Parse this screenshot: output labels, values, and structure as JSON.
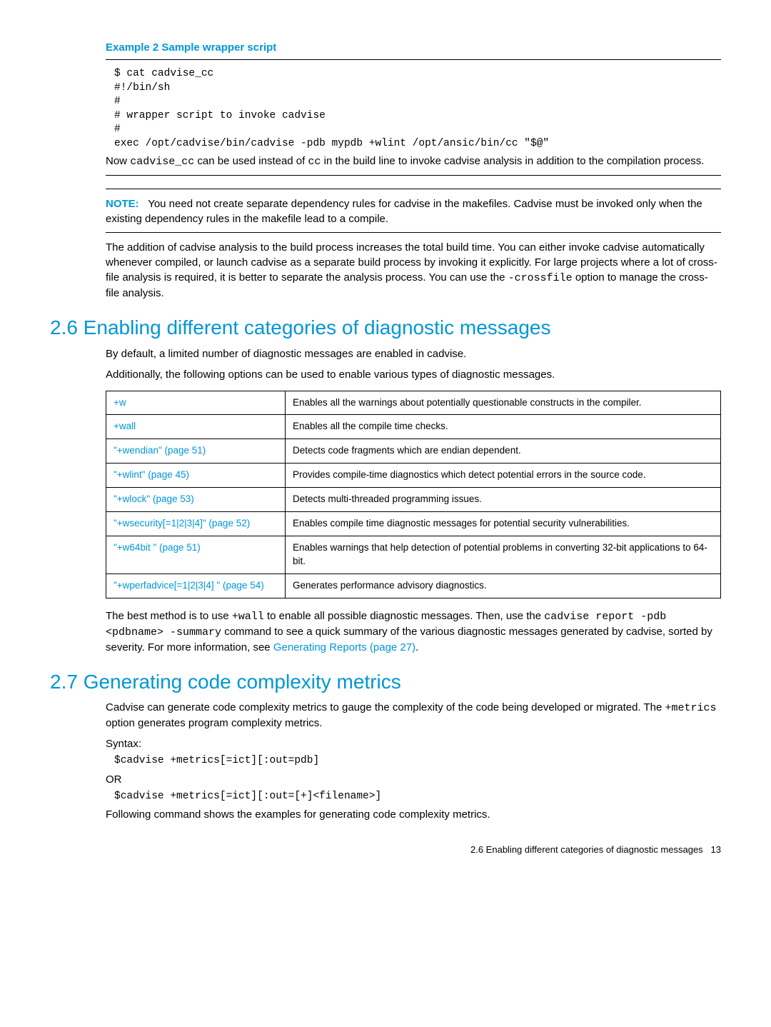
{
  "example": {
    "title": "Example 2 Sample wrapper script",
    "code": "$ cat cadvise_cc\n#!/bin/sh\n#\n# wrapper script to invoke cadvise\n#\nexec /opt/cadvise/bin/cadvise -pdb mypdb +wlint /opt/ansic/bin/cc \"$@\"",
    "after1a": "Now ",
    "after1b": "cadvise_cc",
    "after1c": " can be used instead of ",
    "after1d": "cc",
    "after1e": " in the build line to invoke cadvise analysis in addition to the compilation process."
  },
  "note": {
    "label": "NOTE:",
    "text": "You need not create separate dependency rules for cadvise in the makefiles. Cadvise must be invoked only when the existing dependency rules in the makefile lead to a compile."
  },
  "paraAfterNote_a": "The addition of cadvise analysis to the build process increases the total build time. You can either invoke cadvise automatically whenever compiled, or launch cadvise as a separate build process by invoking it explicitly. For large projects where a lot of cross-file analysis is required, it is better to separate the analysis process. You can use the ",
  "paraAfterNote_b": "-crossfile",
  "paraAfterNote_c": " option to manage the cross-file analysis.",
  "sec26": {
    "heading": "2.6 Enabling different categories of diagnostic messages",
    "p1": "By default, a limited number of diagnostic messages are enabled in cadvise.",
    "p2": "Additionally, the following options can be used to enable various types of diagnostic messages.",
    "rows": [
      {
        "opt": "+w",
        "desc": "Enables all the warnings about potentially questionable constructs in the compiler."
      },
      {
        "opt": "+wall",
        "desc": "Enables all the compile time checks."
      },
      {
        "opt": "\"+wendian\" (page 51)",
        "desc": "Detects code fragments which are endian dependent."
      },
      {
        "opt": "\"+wlint\" (page 45)",
        "desc": "Provides compile-time diagnostics which detect potential errors in the source code."
      },
      {
        "opt": "\"+wlock\" (page 53)",
        "desc": "Detects multi-threaded programming issues."
      },
      {
        "opt": "\"+wsecurity[=1|2|3|4]\" (page 52)",
        "desc": "Enables compile time diagnostic messages for potential security vulnerabilities."
      },
      {
        "opt": "\"+w64bit \" (page 51)",
        "desc": "Enables warnings that help detection of potential problems in converting 32-bit applications to 64-bit."
      },
      {
        "opt": "\"+wperfadvice[=1|2|3|4] \" (page 54)",
        "desc": "Generates performance advisory diagnostics."
      }
    ],
    "p3a": "The best method is to use ",
    "p3b": "+wall",
    "p3c": " to enable all possible diagnostic messages. Then, use the ",
    "p3d": "cadvise report -pdb <pdbname> -summary",
    "p3e": " command to see a quick summary of the various diagnostic messages generated by cadvise, sorted by severity. For more information, see ",
    "p3link": "Generating Reports (page 27)",
    "p3f": "."
  },
  "sec27": {
    "heading": "2.7 Generating code complexity metrics",
    "p1a": "Cadvise can generate code complexity metrics to gauge the complexity of the code being developed or migrated. The ",
    "p1b": "+metrics",
    "p1c": " option generates program complexity metrics.",
    "syntax": "Syntax:",
    "code1": "$cadvise +metrics[=ict][:out=pdb]",
    "or": "OR",
    "code2": "$cadvise +metrics[=ict][:out=[+]<filename>]",
    "p2": "Following command shows the examples for generating code complexity metrics."
  },
  "footer": {
    "text": "2.6 Enabling different categories of diagnostic messages",
    "page": "13"
  }
}
